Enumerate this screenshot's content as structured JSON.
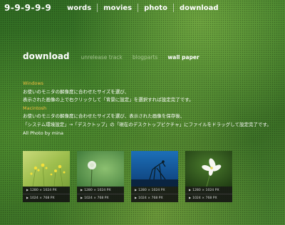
{
  "header": {
    "logo": "9-9-9-9-9",
    "nav": [
      "words",
      "movies",
      "photo",
      "download"
    ]
  },
  "subnav": {
    "title": "download",
    "items": [
      "unrelease track",
      "blogparts",
      "wall paper"
    ],
    "active": "wall paper"
  },
  "instructions": {
    "windows_label": "Windows",
    "windows_line1": "お使いのモニタの解像度に合わせたサイズを選び、",
    "windows_line2": "表示された画像の上で右クリックして「背景に設定」を選択すれば設定完了です。",
    "mac_label": "Macintosh",
    "mac_line1": "お使いのモニタの解像度に合わせたサイズを選び、表示された画像を保存後、",
    "mac_line2": "「システム環境設定」→「デスクトップ」の「現在のデスクトップピクチャ」にファイルをドラッグして設定完了です。"
  },
  "credit": "All Photo by mina",
  "thumbnails": [
    {
      "subject": "yellow-flowers-photo",
      "res1": "1280 × 1024 PX",
      "res2": "1024 × 768 PX"
    },
    {
      "subject": "dandelion-clock-photo",
      "res1": "1280 × 1024 PX",
      "res2": "1024 × 768 PX"
    },
    {
      "subject": "praying-mantis-photo",
      "res1": "1280 × 1024 PX",
      "res2": "1024 × 768 PX"
    },
    {
      "subject": "white-flower-photo",
      "res1": "1280 × 1024 PX",
      "res2": "1024 × 768 PX"
    }
  ],
  "colors": {
    "os_label": "#f0c040",
    "resolution_bar": "#121212"
  }
}
